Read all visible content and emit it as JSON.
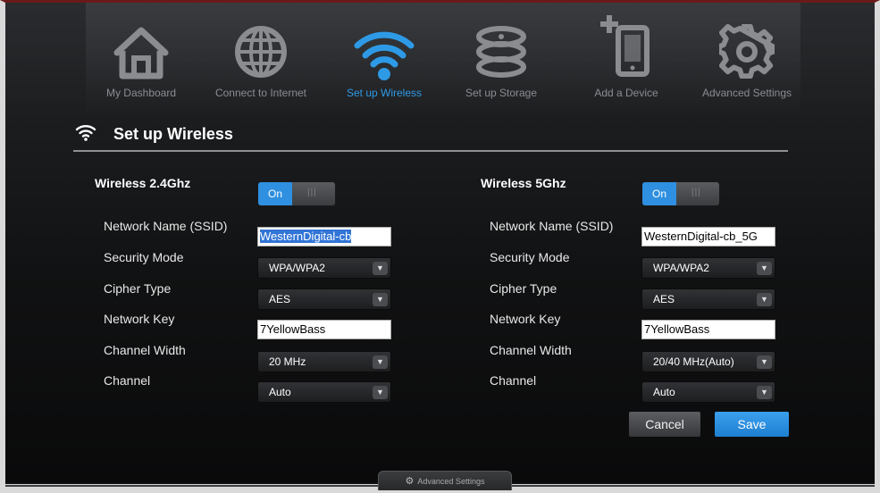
{
  "nav": {
    "items": [
      {
        "label": "My Dashboard",
        "icon": "home-icon"
      },
      {
        "label": "Connect to Internet",
        "icon": "globe-icon"
      },
      {
        "label": "Set up Wireless",
        "icon": "wifi-icon",
        "active": true
      },
      {
        "label": "Set up Storage",
        "icon": "storage-icon"
      },
      {
        "label": "Add a Device",
        "icon": "add-device-icon"
      },
      {
        "label": "Advanced Settings",
        "icon": "gear-icon"
      }
    ]
  },
  "section": {
    "title": "Set up Wireless",
    "icon": "wifi-icon"
  },
  "labels": {
    "network_name": "Network Name (SSID)",
    "security_mode": "Security Mode",
    "cipher_type": "Cipher Type",
    "network_key": "Network Key",
    "channel_width": "Channel Width",
    "channel": "Channel"
  },
  "band24": {
    "title": "Wireless 2.4Ghz",
    "toggle": "On",
    "ssid": "WesternDigital-cb",
    "security_mode": "WPA/WPA2",
    "cipher_type": "AES",
    "network_key": "7YellowBass",
    "channel_width": "20 MHz",
    "channel": "Auto"
  },
  "band5": {
    "title": "Wireless 5Ghz",
    "toggle": "On",
    "ssid": "WesternDigital-cb_5G",
    "security_mode": "WPA/WPA2",
    "cipher_type": "AES",
    "network_key": "7YellowBass",
    "channel_width": "20/40 MHz(Auto)",
    "channel": "Auto"
  },
  "buttons": {
    "cancel": "Cancel",
    "save": "Save"
  },
  "footer": {
    "advanced_tab": "Advanced Settings"
  },
  "colors": {
    "accent": "#2f8fe0",
    "active_nav": "#2e9ae6",
    "inactive_icon": "#8a8c90"
  }
}
